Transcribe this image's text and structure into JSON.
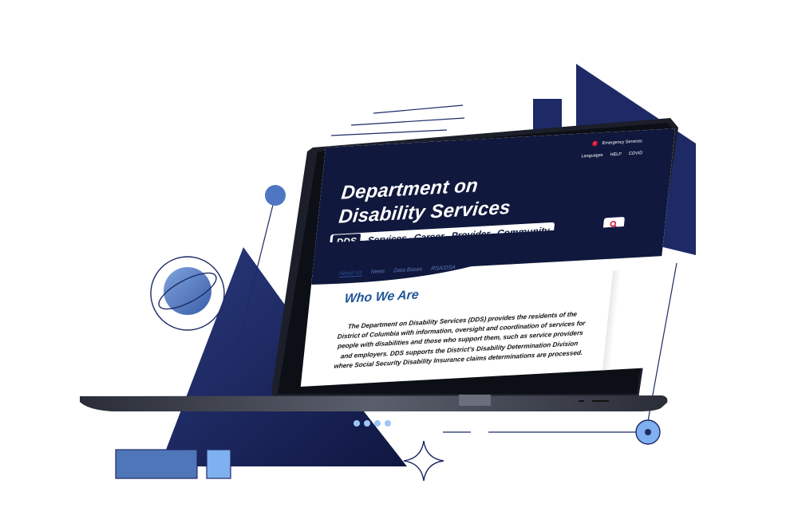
{
  "colors": {
    "navy": "#10183d",
    "illustration_blue": "#1e2a66",
    "light_blue": "#5b7fc4",
    "pale_blue": "#7fb0ef",
    "heading_blue": "#1f5496",
    "alert_red": "#c8102e"
  },
  "site": {
    "utility": {
      "alert_icon": "exclamation-icon",
      "emergency_label": "Emergency Services",
      "links": [
        "Languages",
        "HELP",
        "COVID"
      ]
    },
    "title_line1": "Department on",
    "title_line2": "Disability Services",
    "nav": {
      "logo": "DDS",
      "items": [
        "Services",
        "Career",
        "Provider",
        "Community"
      ]
    },
    "search_icon": "search-icon",
    "subnav": [
      "About Us",
      "News",
      "Data Bases",
      "RSA/DSA"
    ],
    "section_title": "Who We Are",
    "body_lines": [
      "The Department on Disability Services (DDS) provides the residents of the",
      "District of Columbia with information, oversight and coordination of services for",
      "people with disabilities and those who support them, such as service providers",
      "and employers. DDS supports the District’s Disability Determination Division",
      "where Social Security Disability Insurance claims determinations are processed."
    ]
  }
}
